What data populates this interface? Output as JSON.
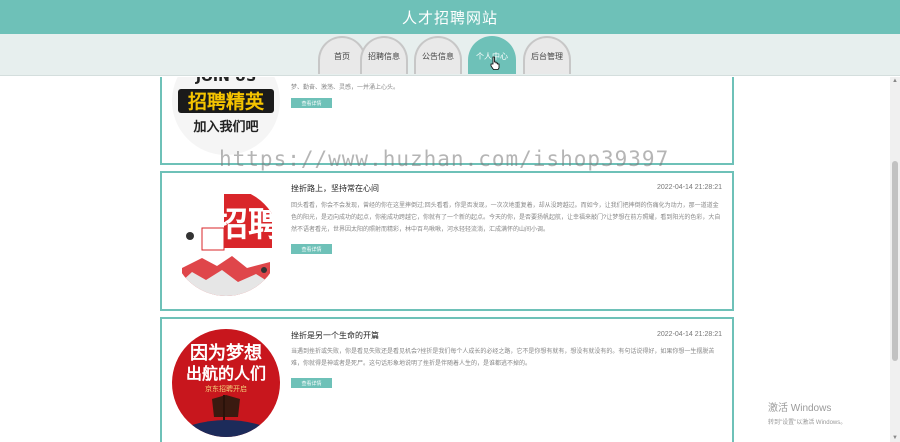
{
  "site": {
    "title": "人才招聘网站"
  },
  "nav": {
    "items": [
      {
        "label": "首页",
        "active": false
      },
      {
        "label": "招聘信息",
        "active": false
      },
      {
        "label": "公告信息",
        "active": false
      },
      {
        "label": "个人中心",
        "active": true
      },
      {
        "label": "后台管理",
        "active": false
      }
    ]
  },
  "cards": [
    {
      "title": "",
      "date": "",
      "desc": "梦、勤奋、激荡、灵感，一并涌上心头。",
      "button": "查看详情",
      "image_text_top": "JOIN US",
      "image_text_main": "招聘精英",
      "image_text_sub": "加入我们吧"
    },
    {
      "title": "挫折路上，坚持常在心间",
      "date": "2022-04-14 21:28:21",
      "desc": "回头看看，你会不会发现，曾经的你在这里摔倒过;回头看看，你是否发现，一次次地重复着，却从没跨越过。而如今，让我们把摔倒的伤痛化为动力，那一道道金色的阳光，是迈向成功的起点，你能成功跨越它，你就有了一个新的起点。今天的你，是否要扬帆起航，让幸福来敲门?让梦想在前方照耀，看到阳光的色彩，大自然不语者看光，世界因太阳的照射而精彩，林中百鸟啾啾，河水轻轻流淌，汇成满怀的山间小调。",
      "button": "查看详情",
      "image_text_main": "招聘"
    },
    {
      "title": "挫折是另一个生命的开篇",
      "date": "2022-04-14 21:28:21",
      "desc": "当遇到挫折或失败，你是看见失败还是看见机会?挫折是我们每个人成长的必经之路，它不是你想有就有，想没有就没有的。有句话说得好，如果你想一生摆脱苦难，你就得是神或者是死尸。这句话形象地说明了挫折是伴随着人生的，是谁都逃不掉的。",
      "button": "查看详情",
      "image_text_main": "因为梦想",
      "image_text_sub": "出航的人们",
      "image_text_small": "京东招聘开启"
    }
  ],
  "overlay": {
    "watermark": "https://www.huzhan.com/ishop39397",
    "activate_title": "激活 Windows",
    "activate_sub": "转到\"设置\"以激活 Windows。"
  },
  "colors": {
    "accent": "#6ec1b8",
    "nav_bg": "#e7efee",
    "red": "#d9262a"
  }
}
